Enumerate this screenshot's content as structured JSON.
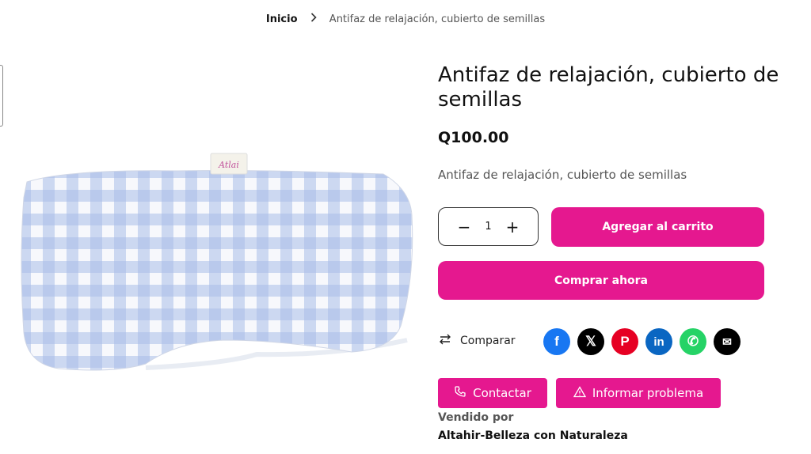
{
  "breadcrumb": {
    "home": "Inicio",
    "current": "Antifaz de relajación, cubierto de semillas"
  },
  "product": {
    "title": "Antifaz de relajación, cubierto de semillas",
    "price": "Q100.00",
    "description": "Antifaz de relajación, cubierto de semillas",
    "quantity": "1",
    "image": {
      "label_text": "Atlai"
    }
  },
  "actions": {
    "add_to_cart": "Agregar al carrito",
    "buy_now": "Comprar ahora",
    "compare": "Comparar",
    "contact": "Contactar",
    "report": "Informar problema"
  },
  "share": [
    {
      "name": "facebook",
      "glyph": "f",
      "color": "#1877f2"
    },
    {
      "name": "x",
      "glyph": "𝕏",
      "color": "#000000"
    },
    {
      "name": "pinterest",
      "glyph": "P",
      "color": "#e60023"
    },
    {
      "name": "linkedin",
      "glyph": "in",
      "color": "#0a66c2"
    },
    {
      "name": "whatsapp",
      "glyph": "✆",
      "color": "#25d366"
    },
    {
      "name": "email",
      "glyph": "✉",
      "color": "#000000"
    }
  ],
  "seller": {
    "label": "Vendido por",
    "name": "Altahir-Belleza con Naturaleza"
  },
  "colors": {
    "accent": "#e5188f",
    "check_blue": "#a9bde6",
    "check_white": "#f7f8fc"
  }
}
